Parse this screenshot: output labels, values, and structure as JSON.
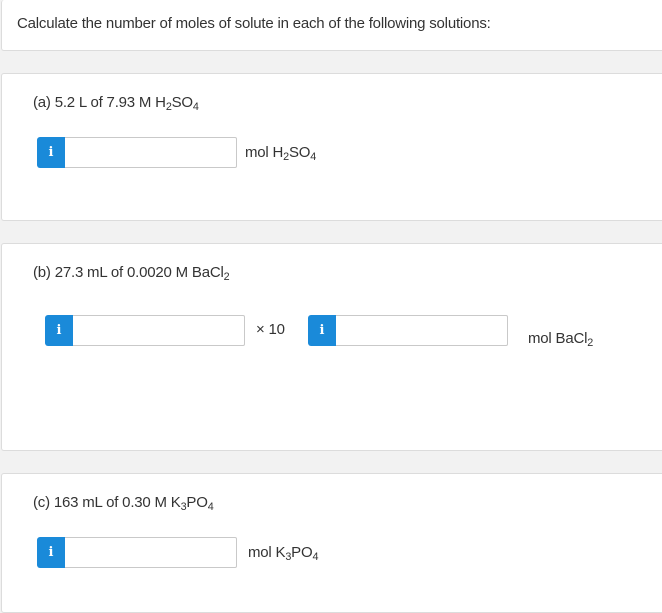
{
  "header": {
    "instruction": "Calculate the number of moles of solute in each of the following solutions:"
  },
  "questions": [
    {
      "label_prefix": "(a) 5.2 L of 7.93 M H",
      "label_sub1": "2",
      "label_mid": "SO",
      "label_sub2": "4",
      "info_glyph": "i",
      "input_value": "",
      "unit_prefix": "mol H",
      "unit_sub1": "2",
      "unit_mid": "SO",
      "unit_sub2": "4"
    },
    {
      "label_prefix": "(b) 27.3 mL of 0.0020 M BaCl",
      "label_sub1": "2",
      "info_glyph": "i",
      "mantissa_value": "",
      "times_ten": "× 10",
      "exponent_info_glyph": "i",
      "exponent_value": "",
      "unit_prefix": "mol BaCl",
      "unit_sub1": "2"
    },
    {
      "label_prefix": "(c) 163  mL of 0.30 M K",
      "label_sub1": "3",
      "label_mid": "PO",
      "label_sub2": "4",
      "info_glyph": "i",
      "input_value": "",
      "unit_prefix": "mol K",
      "unit_sub1": "3",
      "unit_mid": "PO",
      "unit_sub2": "4"
    }
  ],
  "colors": {
    "info_button": "#1a8ad9",
    "card_border": "#dcdcdc",
    "background": "#f2f2f2",
    "text": "#333333"
  }
}
